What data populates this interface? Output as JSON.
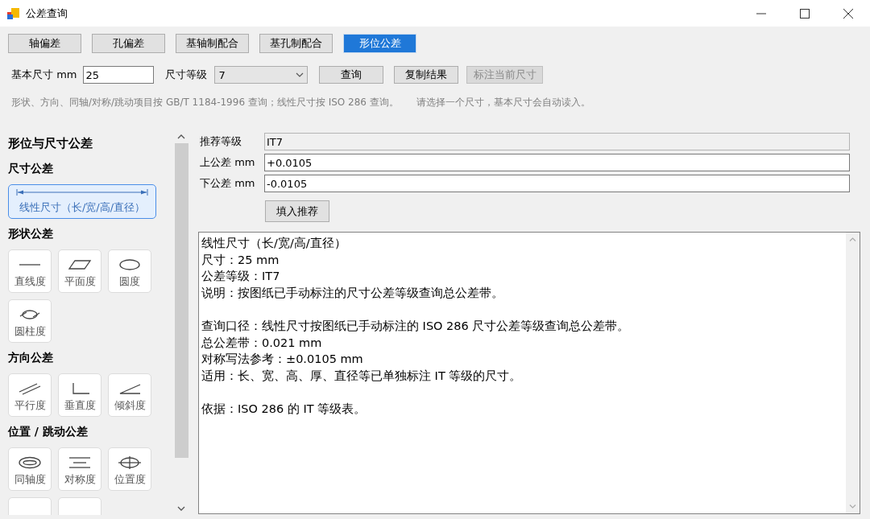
{
  "window": {
    "title": "公差查询"
  },
  "tabs": [
    {
      "label": "轴偏差",
      "selected": false
    },
    {
      "label": "孔偏差",
      "selected": false
    },
    {
      "label": "基轴制配合",
      "selected": false
    },
    {
      "label": "基孔制配合",
      "selected": false
    },
    {
      "label": "形位公差",
      "selected": true
    }
  ],
  "query_bar": {
    "size_label": "基本尺寸 mm",
    "size_value": "25",
    "grade_label": "尺寸等级",
    "grade_value": "7",
    "buttons": [
      {
        "label": "查询",
        "disabled": false
      },
      {
        "label": "复制结果",
        "disabled": false
      },
      {
        "label": "标注当前尺寸",
        "disabled": true
      }
    ]
  },
  "hint": "形状、方向、同轴/对称/跳动项目按 GB/T 1184-1996 查询；线性尺寸按 ISO 286 查询。",
  "hint_2": "请选择一个尺寸，基本尺寸会自动读入。",
  "sidebar": {
    "title": "形位与尺寸公差",
    "sections": [
      {
        "title": "尺寸公差",
        "items": [
          {
            "kind": "linear",
            "label": "线性尺寸（长/宽/高/直径）",
            "selected": true
          }
        ]
      },
      {
        "title": "形状公差",
        "items": [
          {
            "kind": "straightness",
            "label": "直线度",
            "selected": false
          },
          {
            "kind": "flatness",
            "label": "平面度",
            "selected": false
          },
          {
            "kind": "circularity",
            "label": "圆度",
            "selected": false
          },
          {
            "kind": "cylindricity",
            "label": "圆柱度",
            "selected": false
          }
        ]
      },
      {
        "title": "方向公差",
        "items": [
          {
            "kind": "parallelism",
            "label": "平行度",
            "selected": false
          },
          {
            "kind": "perpendicularity",
            "label": "垂直度",
            "selected": false
          },
          {
            "kind": "angularity",
            "label": "倾斜度",
            "selected": false
          }
        ]
      },
      {
        "title": "位置 / 跳动公差",
        "items": [
          {
            "kind": "concentricity",
            "label": "同轴度",
            "selected": false
          },
          {
            "kind": "symmetry",
            "label": "对称度",
            "selected": false
          },
          {
            "kind": "position",
            "label": "位置度",
            "selected": false
          },
          {
            "kind": "partial"
          },
          {
            "kind": "partial"
          }
        ]
      }
    ]
  },
  "result": {
    "fields": [
      {
        "label": "推荐等级",
        "value": "IT7",
        "readonly": true
      },
      {
        "label": "上公差 mm",
        "value": "+0.0105",
        "readonly": false
      },
      {
        "label": "下公差 mm",
        "value": "-0.0105",
        "readonly": false
      }
    ],
    "fill_button": "填入推荐",
    "paragraphs": [
      [
        "线性尺寸（长/宽/高/直径）",
        "尺寸：25 mm",
        "公差等级：IT7",
        "说明：按图纸已手动标注的尺寸公差等级查询总公差带。"
      ],
      [
        "查询口径：线性尺寸按图纸已手动标注的 ISO 286 尺寸公差等级查询总公差带。",
        "总公差带：0.021 mm",
        "对称写法参考：±0.0105 mm",
        "适用：长、宽、高、厚、直径等已单独标注 IT 等级的尺寸。"
      ],
      [
        "依据：ISO 286 的 IT 等级表。"
      ]
    ]
  }
}
